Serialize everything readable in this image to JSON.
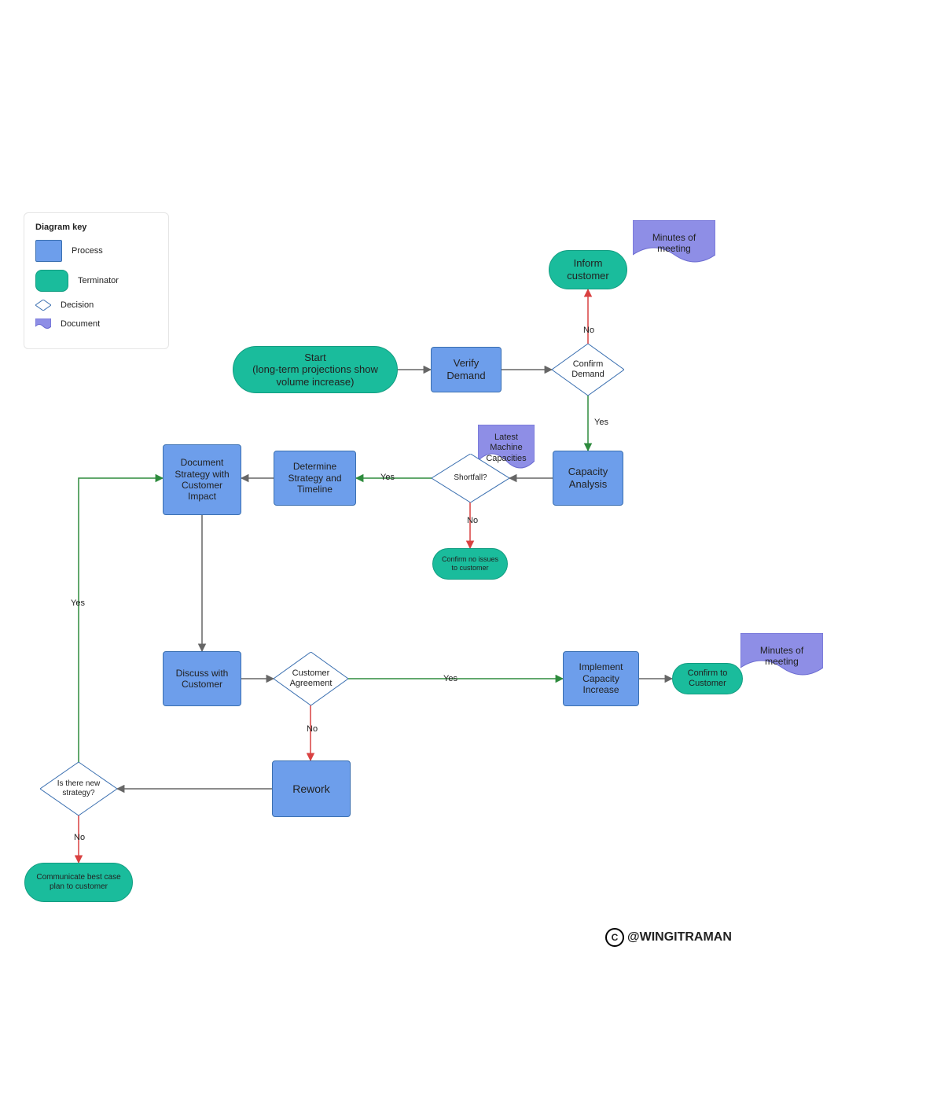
{
  "key": {
    "title": "Diagram key",
    "process": "Process",
    "terminator": "Terminator",
    "decision": "Decision",
    "document": "Document"
  },
  "nodes": {
    "start": "Start\n(long-term projections show volume increase)",
    "verify_demand": "Verify Demand",
    "confirm_demand": "Confirm Demand",
    "inform_customer": "Inform customer",
    "minutes_top": "Minutes of meeting",
    "capacity_analysis": "Capacity Analysis",
    "latest_capacities": "Latest Machine Capacities",
    "shortfall": "Shortfall?",
    "confirm_no_issues": "Confirm no issues to customer",
    "determine_strategy": "Determine Strategy and Timeline",
    "document_strategy": "Document Strategy with Customer Impact",
    "discuss_customer": "Discuss with Customer",
    "customer_agreement": "Customer Agreement",
    "rework": "Rework",
    "new_strategy": "Is there new strategy?",
    "best_case": "Communicate best case plan to customer",
    "implement": "Implement Capacity Increase",
    "confirm_customer": "Confirm to Customer",
    "minutes_bottom": "Minutes of meeting"
  },
  "edges": {
    "no": "No",
    "yes": "Yes"
  },
  "watermark": "@WINGITRAMAN",
  "colors": {
    "process": "#6d9eeb",
    "terminator": "#1abc9c",
    "document": "#8e8ee6",
    "decision_border": "#3a6fb0",
    "edge_default": "#666666",
    "edge_yes": "#2e8b3d",
    "edge_no": "#d94141"
  }
}
